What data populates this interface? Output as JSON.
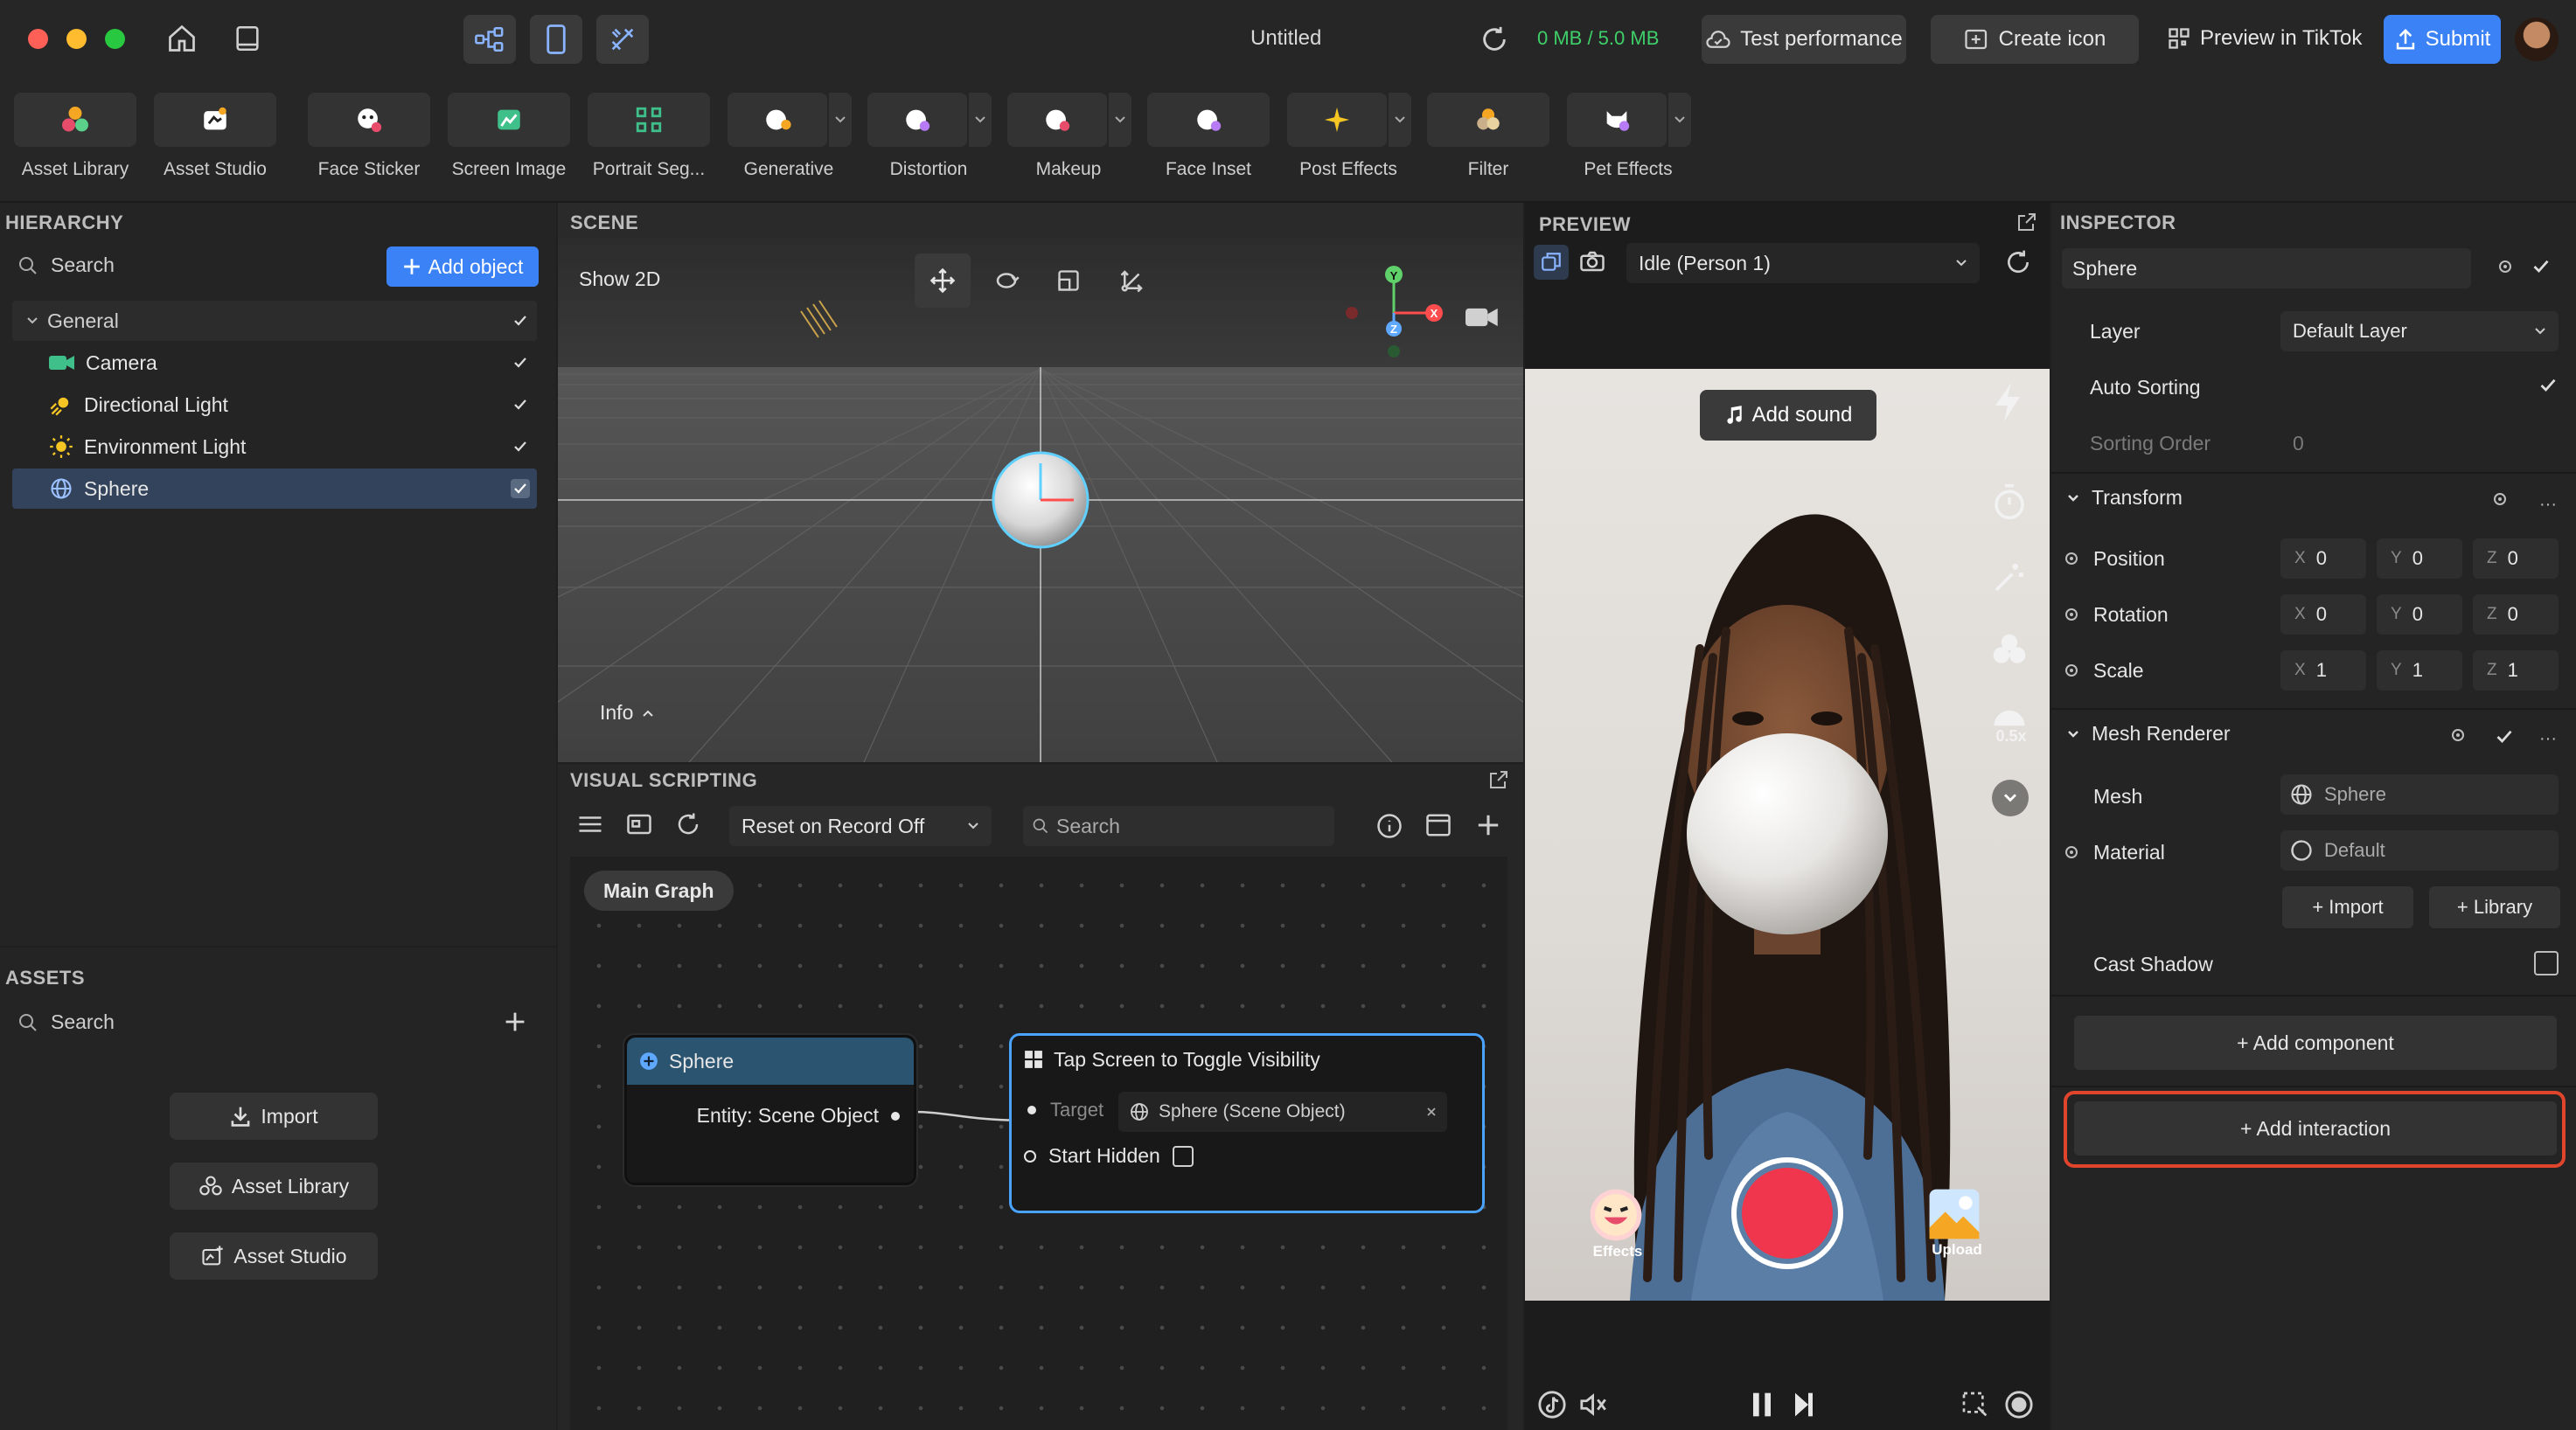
{
  "titlebar": {
    "title": "Untitled",
    "storage": "0 MB / 5.0 MB",
    "test_performance": "Test performance",
    "create_icon": "Create icon",
    "preview_in_tiktok": "Preview in TikTok",
    "submit": "Submit"
  },
  "toolbar": {
    "items": [
      {
        "label": "Asset Library"
      },
      {
        "label": "Asset Studio"
      },
      {
        "label": "Face Sticker"
      },
      {
        "label": "Screen Image"
      },
      {
        "label": "Portrait Seg..."
      },
      {
        "label": "Generative"
      },
      {
        "label": "Distortion"
      },
      {
        "label": "Makeup"
      },
      {
        "label": "Face Inset"
      },
      {
        "label": "Post Effects"
      },
      {
        "label": "Filter"
      },
      {
        "label": "Pet Effects"
      }
    ]
  },
  "hierarchy": {
    "title": "HIERARCHY",
    "search_placeholder": "Search",
    "add_object": "Add object",
    "group": "General",
    "items": [
      {
        "label": "Camera"
      },
      {
        "label": "Directional Light"
      },
      {
        "label": "Environment Light"
      },
      {
        "label": "Sphere"
      }
    ]
  },
  "assets": {
    "title": "ASSETS",
    "search_placeholder": "Search",
    "import": "Import",
    "asset_library": "Asset Library",
    "asset_studio": "Asset Studio"
  },
  "scene": {
    "title": "SCENE",
    "show_2d": "Show 2D",
    "info": "Info",
    "gizmo": {
      "y": "Y",
      "x": "X",
      "z": "Z"
    }
  },
  "visual_scripting": {
    "title": "VISUAL SCRIPTING",
    "reset_mode": "Reset on Record Off",
    "search_placeholder": "Search",
    "main_graph": "Main Graph",
    "node_sphere": {
      "title": "Sphere",
      "port": "Entity: Scene Object"
    },
    "node_toggle": {
      "title": "Tap Screen to Toggle Visibility",
      "target_label": "Target",
      "target_value": "Sphere (Scene Object)",
      "start_hidden": "Start Hidden"
    }
  },
  "preview": {
    "title": "PREVIEW",
    "mode": "Idle (Person 1)",
    "add_sound": "Add sound",
    "speed": "0.5x",
    "effects": "Effects",
    "upload": "Upload"
  },
  "inspector": {
    "title": "INSPECTOR",
    "object_name": "Sphere",
    "layer_label": "Layer",
    "layer_value": "Default Layer",
    "auto_sorting": "Auto Sorting",
    "sorting_order_label": "Sorting Order",
    "sorting_order_value": "0",
    "transform": "Transform",
    "position": {
      "label": "Position",
      "x": "0",
      "y": "0",
      "z": "0"
    },
    "rotation": {
      "label": "Rotation",
      "x": "0",
      "y": "0",
      "z": "0"
    },
    "scale": {
      "label": "Scale",
      "x": "1",
      "y": "1",
      "z": "1"
    },
    "axis_labels": {
      "x": "X",
      "y": "Y",
      "z": "Z"
    },
    "mesh_renderer": "Mesh Renderer",
    "mesh_label": "Mesh",
    "mesh_value": "Sphere",
    "material_label": "Material",
    "material_value": "Default",
    "import": "+ Import",
    "library": "+ Library",
    "cast_shadow": "Cast Shadow",
    "add_component": "+ Add component",
    "add_interaction": "+ Add interaction"
  },
  "colors": {
    "accent": "#3b82f6",
    "storage_green": "#3ecf6a",
    "highlight_red": "#e0452c",
    "record_red": "#f0364d"
  }
}
